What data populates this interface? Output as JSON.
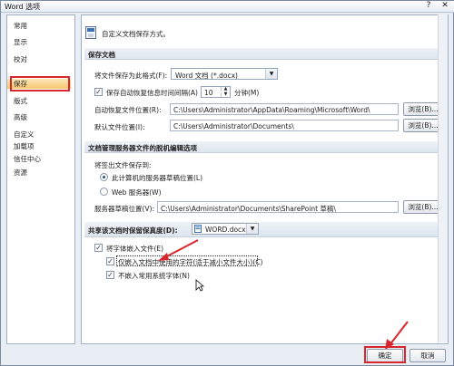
{
  "window": {
    "title": "Word 选项",
    "help_label": "?",
    "close_label": "✕"
  },
  "sidebar": {
    "items": [
      {
        "label": "常用"
      },
      {
        "label": "显示"
      },
      {
        "label": "校对"
      },
      {
        "label": "保存"
      },
      {
        "label": "版式"
      },
      {
        "label": "高级"
      },
      {
        "label": "自定义"
      },
      {
        "label": "加载项"
      },
      {
        "label": "信任中心"
      },
      {
        "label": "资源"
      }
    ],
    "active_index": 3
  },
  "main": {
    "intro": "自定义文档保存方式。",
    "save_section": {
      "title": "保存文档",
      "format_label": "将文件保存为此格式(F):",
      "format_value": "Word 文档 (*.docx)",
      "autorecover_label": "保存自动恢复信息时间间隔(A)",
      "autorecover_checked": true,
      "autorecover_minutes": "10",
      "minutes_label": "分钟(M)",
      "autorecover_path_label": "自动恢复文件位置(R):",
      "autorecover_path": "C:\\Users\\Administrator\\AppData\\Roaming\\Microsoft\\Word\\",
      "default_path_label": "默认文件位置(I):",
      "default_path": "C:\\Users\\Administrator\\Documents\\",
      "browse_label": "浏览(B)..."
    },
    "server_section": {
      "title": "文档管理服务器文件的脱机编辑选项",
      "save_to_label": "将签出文件保存到:",
      "option_local": "此计算机的服务器草稿位置(L)",
      "option_web": "Web 服务器(W)",
      "drafts_label": "服务器草稿位置(V):",
      "drafts_path": "C:\\Users\\Administrator\\Documents\\SharePoint 草稿\\",
      "browse_label": "浏览(B)..."
    },
    "fidelity_section": {
      "title": "共享该文档时保留保真度(D):",
      "doc_value": "WORD.docx",
      "embed_fonts_label": "将字体嵌入文件(E)",
      "embed_fonts_checked": true,
      "embed_used_label": "仅嵌入文档中使用的字符(适于减小文件大小)(C)",
      "embed_used_checked": true,
      "no_common_label": "不嵌入常用系统字体(N)",
      "no_common_checked": true
    }
  },
  "footer": {
    "ok_label": "确定",
    "cancel_label": "取消"
  },
  "colors": {
    "highlight_red": "#d8262c",
    "active_item": "#f6c770"
  }
}
